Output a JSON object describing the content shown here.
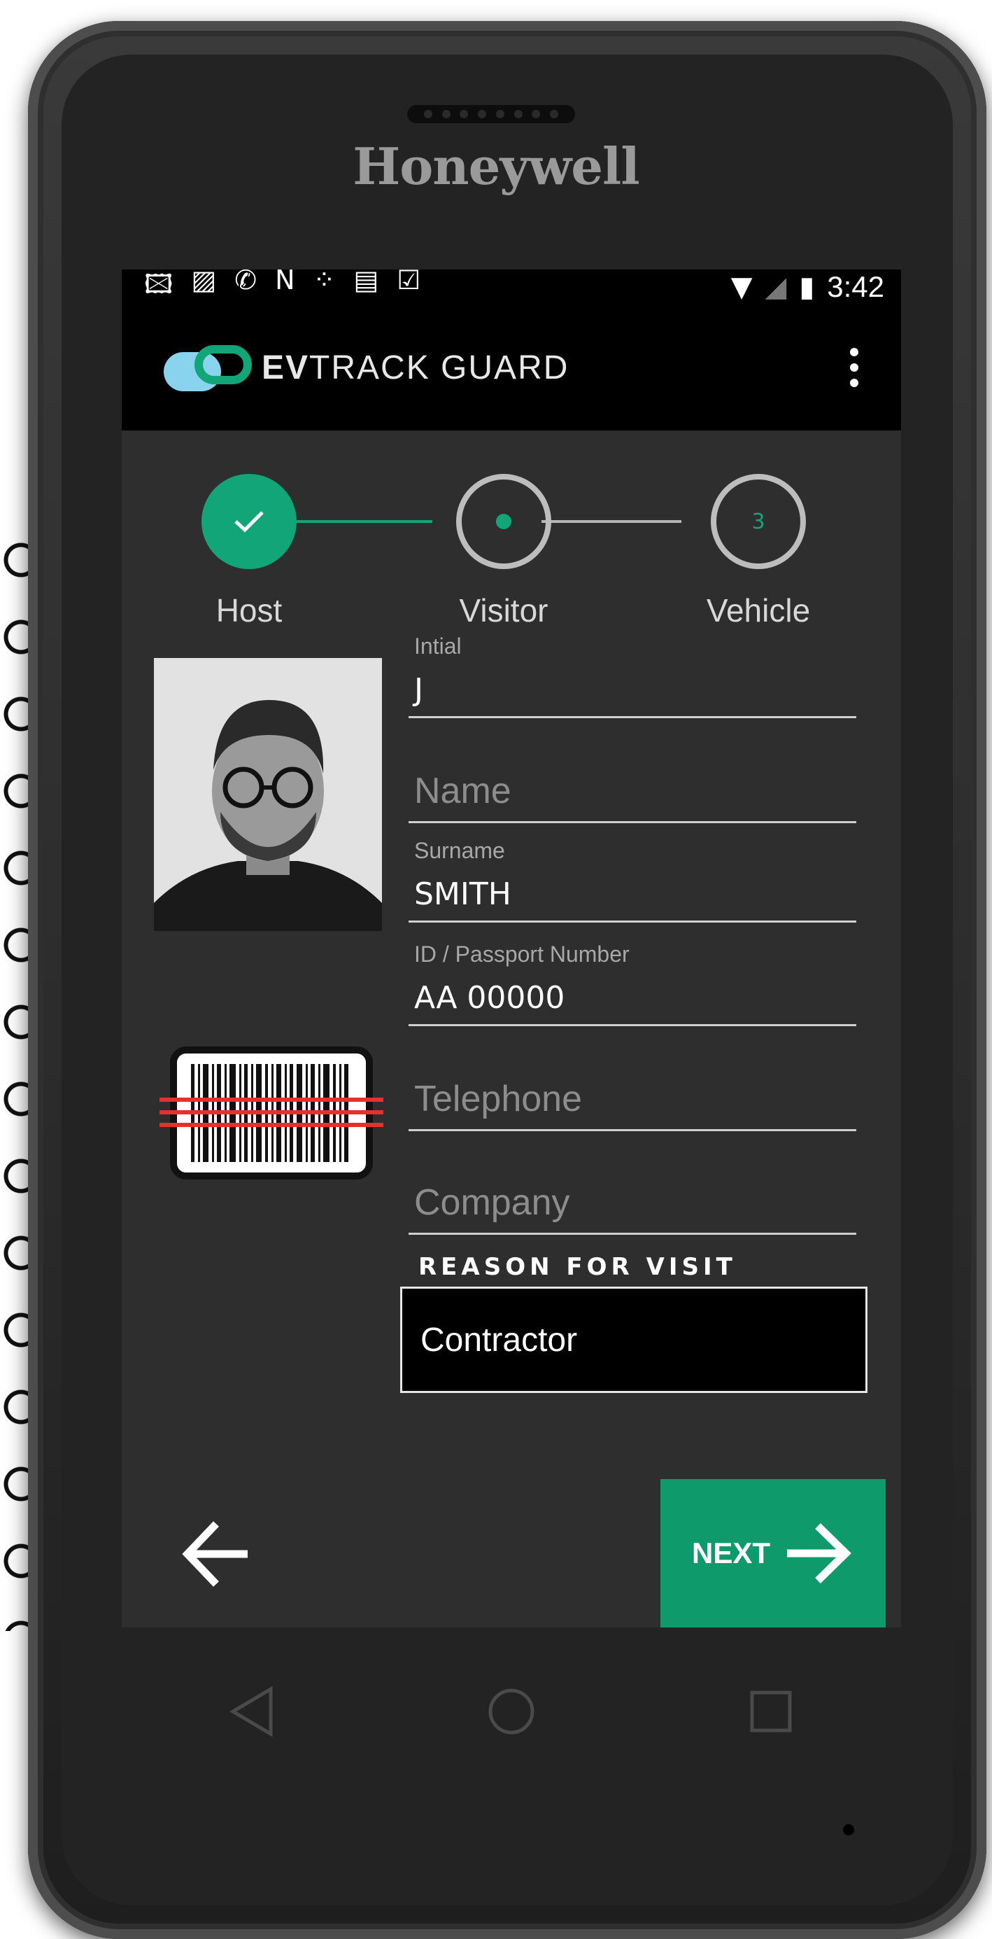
{
  "device": {
    "brand": "Honeywell"
  },
  "statusbar": {
    "time": "3:42",
    "icons_left": [
      "gallery-icon",
      "image-icon",
      "phone-icon",
      "nfc-icon",
      "dots-icon",
      "sd-card-icon",
      "task-icon"
    ],
    "icons_right": [
      "wifi-icon",
      "no-signal-icon",
      "battery-charging-icon"
    ]
  },
  "appbar": {
    "logo_bold": "EV",
    "logo_rest": "TRACK GUARD"
  },
  "stepper": {
    "steps": [
      {
        "label": "Host",
        "state": "completed"
      },
      {
        "label": "Visitor",
        "state": "active"
      },
      {
        "label": "Vehicle",
        "state": "pending",
        "number": "3"
      }
    ],
    "accent": "#11a578"
  },
  "form": {
    "initial": {
      "label": "Intial",
      "value": "J"
    },
    "name": {
      "placeholder": "Name"
    },
    "surname": {
      "label": "Surname",
      "value": "SMITH"
    },
    "id_number": {
      "label": "ID / Passport Number",
      "value": "AA 00000"
    },
    "telephone": {
      "placeholder": "Telephone"
    },
    "company": {
      "placeholder": "Company"
    },
    "reason": {
      "label": "REASON FOR VISIT",
      "value": "Contractor"
    }
  },
  "actions": {
    "next_label": "NEXT"
  },
  "colors": {
    "accent": "#0e9a6b",
    "screen_bg": "#2e2e2e",
    "appbar_bg": "#000000"
  }
}
